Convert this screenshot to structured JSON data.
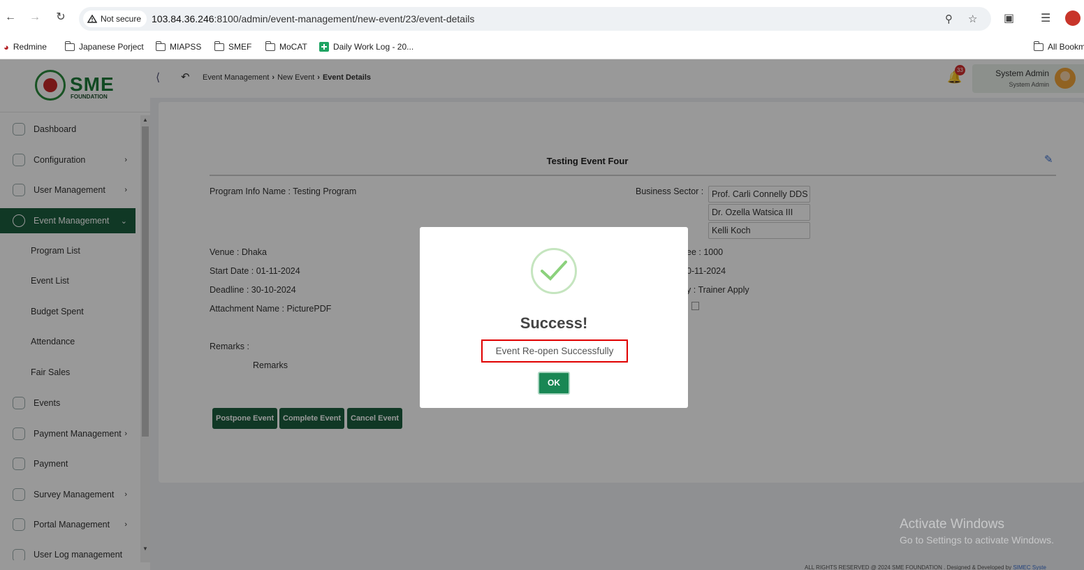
{
  "browser": {
    "security_label": "Not secure",
    "url_host": "103.84.36.246",
    "url_rest": ":8100/admin/event-management/new-event/23/event-details",
    "bookmarks": [
      "Redmine",
      "Japanese Porject",
      "MIAPSS",
      "SMEF",
      "MoCAT",
      "Daily Work Log - 20...",
      "All Bookm"
    ]
  },
  "logo": {
    "text": "SME",
    "subtitle": "FOUNDATION"
  },
  "sidebar": {
    "items": [
      {
        "label": "Dashboard"
      },
      {
        "label": "Configuration"
      },
      {
        "label": "User Management"
      },
      {
        "label": "Event Management"
      },
      {
        "label": "Events"
      },
      {
        "label": "Payment Management"
      },
      {
        "label": "Payment"
      },
      {
        "label": "Survey Management"
      },
      {
        "label": "Portal Management"
      },
      {
        "label": "User Log management"
      }
    ],
    "subitems": [
      "Program List",
      "Event List",
      "Budget Spent",
      "Attendance",
      "Fair Sales"
    ]
  },
  "topbar": {
    "breadcrumb": [
      "Event Management",
      "New Event",
      "Event Details"
    ],
    "notification_count": "33",
    "user_name": "System Admin",
    "user_role": "System Admin"
  },
  "event": {
    "title": "Testing Event Four",
    "program_info": "Program Info Name :  Testing Program",
    "business_sector_label": "Business Sector :",
    "sectors": [
      "Prof. Carli Connelly DDS",
      "Dr. Ozella Watsica III",
      "Kelli Koch"
    ],
    "venue": "Venue :  Dhaka",
    "start_date": "Start Date :  01-11-2024",
    "deadline": "Deadline :  30-10-2024",
    "attachment": "Attachment Name :  PicturePDF",
    "remarks_label": "Remarks :",
    "remarks_value": "Remarks",
    "right_fee": "ee :  1000",
    "right_date": "0-11-2024",
    "right_type": "y :  Trainer Apply"
  },
  "actions": {
    "postpone": "Postpone Event",
    "complete": "Complete Event",
    "cancel": "Cancel Event"
  },
  "footer": {
    "text": "ALL RIGHTS RESERVED @ 2024 SME FOUNDATION . Designed & Developed by",
    "link": "SIMEC Syste"
  },
  "watermark": {
    "line1": "Activate Windows",
    "line2": "Go to Settings to activate Windows."
  },
  "modal": {
    "title": "Success!",
    "message": "Event Re-open Successfully",
    "ok": "OK"
  }
}
